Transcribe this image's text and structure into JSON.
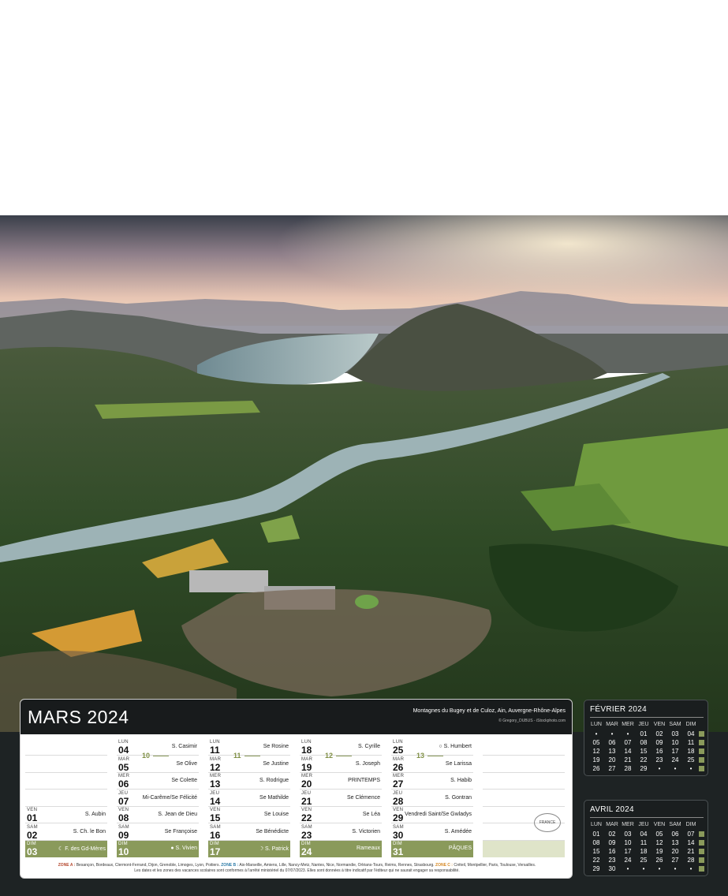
{
  "main": {
    "month_title": "MARS 2024",
    "caption": "Montagnes du Bugey et de Culoz, Ain, Auvergne-Rhône-Alpes",
    "credit": "© Gregory_DUBUS - iStockphoto.com",
    "stamp": "FRANCE",
    "weeks": [
      "10",
      "11",
      "12",
      "13"
    ],
    "col0": [
      {
        "dn": "VEN",
        "dd": "01",
        "sn": "S. Aubin"
      },
      {
        "dn": "SAM",
        "dd": "02",
        "sn": "S. Ch. le Bon"
      },
      {
        "dn": "DIM",
        "dd": "03",
        "sn": "☾ F. des Gd-Mères"
      }
    ],
    "col1": [
      {
        "dn": "LUN",
        "dd": "04",
        "sn": "S. Casimir"
      },
      {
        "dn": "MAR",
        "dd": "05",
        "sn": "Se Olive"
      },
      {
        "dn": "MER",
        "dd": "06",
        "sn": "Se Colette"
      },
      {
        "dn": "JEU",
        "dd": "07",
        "sn": "Mi-Carême/Se Félicité"
      },
      {
        "dn": "VEN",
        "dd": "08",
        "sn": "S. Jean de Dieu"
      },
      {
        "dn": "SAM",
        "dd": "09",
        "sn": "Se Françoise"
      },
      {
        "dn": "DIM",
        "dd": "10",
        "sn": "● S. Vivien"
      }
    ],
    "col2": [
      {
        "dn": "LUN",
        "dd": "11",
        "sn": "Se Rosine"
      },
      {
        "dn": "MAR",
        "dd": "12",
        "sn": "Se Justine"
      },
      {
        "dn": "MER",
        "dd": "13",
        "sn": "S. Rodrigue"
      },
      {
        "dn": "JEU",
        "dd": "14",
        "sn": "Se Mathilde"
      },
      {
        "dn": "VEN",
        "dd": "15",
        "sn": "Se Louise"
      },
      {
        "dn": "SAM",
        "dd": "16",
        "sn": "Se Bénédicte"
      },
      {
        "dn": "DIM",
        "dd": "17",
        "sn": "☽ S. Patrick"
      }
    ],
    "col3": [
      {
        "dn": "LUN",
        "dd": "18",
        "sn": "S. Cyrille"
      },
      {
        "dn": "MAR",
        "dd": "19",
        "sn": "S. Joseph"
      },
      {
        "dn": "MER",
        "dd": "20",
        "sn": "PRINTEMPS"
      },
      {
        "dn": "JEU",
        "dd": "21",
        "sn": "Se Clémence"
      },
      {
        "dn": "VEN",
        "dd": "22",
        "sn": "Se Léa"
      },
      {
        "dn": "SAM",
        "dd": "23",
        "sn": "S. Victorien"
      },
      {
        "dn": "DIM",
        "dd": "24",
        "sn": "Rameaux"
      }
    ],
    "col4": [
      {
        "dn": "LUN",
        "dd": "25",
        "sn": "○ S. Humbert"
      },
      {
        "dn": "MAR",
        "dd": "26",
        "sn": "Se Larissa"
      },
      {
        "dn": "MER",
        "dd": "27",
        "sn": "S. Habib"
      },
      {
        "dn": "JEU",
        "dd": "28",
        "sn": "S. Gontran"
      },
      {
        "dn": "VEN",
        "dd": "29",
        "sn": "Vendredi Saint/Se Gwladys"
      },
      {
        "dn": "SAM",
        "dd": "30",
        "sn": "S. Amédée"
      },
      {
        "dn": "DIM",
        "dd": "31",
        "sn": "PÂQUES"
      }
    ],
    "zones": {
      "a_label": "ZONE A :",
      "a_text": "Besançon, Bordeaux, Clermont-Ferrand, Dijon, Grenoble, Limoges, Lyon, Poitiers.",
      "b_label": "ZONE B :",
      "b_text": "Aix-Marseille, Amiens, Lille, Nancy-Metz, Nantes, Nice, Normandie, Orléans-Tours, Reims, Rennes, Strasbourg.",
      "c_label": "ZONE C :",
      "c_text": "Créteil, Montpellier, Paris, Toulouse, Versailles.",
      "note": "Les dates et les zones des vacances scolaires sont conformes à l'arrêté ministériel du 07/07/2023. Elles sont données à titre indicatif par l'éditeur qui ne saurait engager sa responsabilité."
    }
  },
  "feb": {
    "title": "FÉVRIER 2024",
    "weekdays": [
      "LUN",
      "MAR",
      "MER",
      "JEU",
      "VEN",
      "SAM",
      "DIM"
    ],
    "rows": [
      [
        "•",
        "•",
        "•",
        "01",
        "02",
        "03",
        "04"
      ],
      [
        "05",
        "06",
        "07",
        "08",
        "09",
        "10",
        "11"
      ],
      [
        "12",
        "13",
        "14",
        "15",
        "16",
        "17",
        "18"
      ],
      [
        "19",
        "20",
        "21",
        "22",
        "23",
        "24",
        "25"
      ],
      [
        "26",
        "27",
        "28",
        "29",
        "•",
        "•",
        "•"
      ]
    ]
  },
  "apr": {
    "title": "AVRIL 2024",
    "weekdays": [
      "LUN",
      "MAR",
      "MER",
      "JEU",
      "VEN",
      "SAM",
      "DIM"
    ],
    "rows": [
      [
        "01",
        "02",
        "03",
        "04",
        "05",
        "06",
        "07"
      ],
      [
        "08",
        "09",
        "10",
        "11",
        "12",
        "13",
        "14"
      ],
      [
        "15",
        "16",
        "17",
        "18",
        "19",
        "20",
        "21"
      ],
      [
        "22",
        "23",
        "24",
        "25",
        "26",
        "27",
        "28"
      ],
      [
        "29",
        "30",
        "•",
        "•",
        "•",
        "•",
        "•"
      ]
    ]
  },
  "colors": {
    "accent_green": "#8a9a5b",
    "panel_dark": "#181b1c"
  }
}
